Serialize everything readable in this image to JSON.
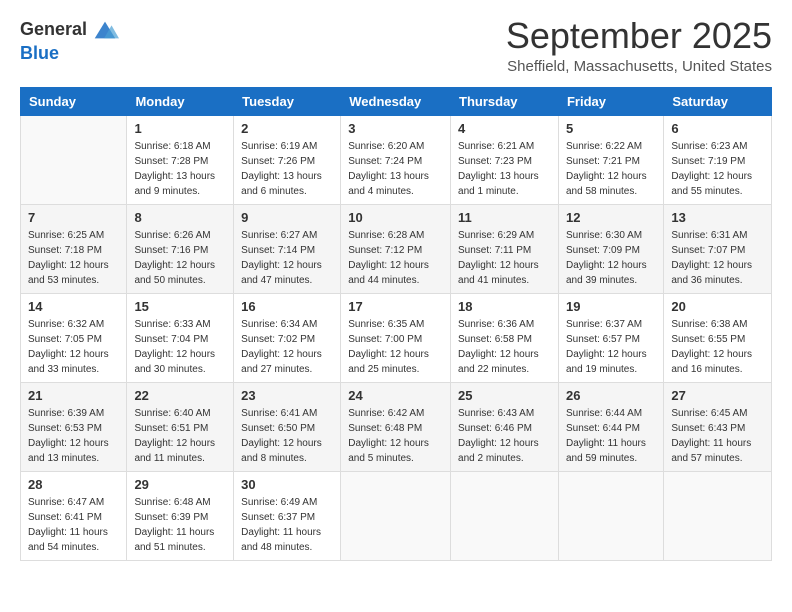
{
  "logo": {
    "general": "General",
    "blue": "Blue"
  },
  "header": {
    "month": "September 2025",
    "location": "Sheffield, Massachusetts, United States"
  },
  "weekdays": [
    "Sunday",
    "Monday",
    "Tuesday",
    "Wednesday",
    "Thursday",
    "Friday",
    "Saturday"
  ],
  "weeks": [
    [
      {
        "day": "",
        "sunrise": "",
        "sunset": "",
        "daylight": ""
      },
      {
        "day": "1",
        "sunrise": "Sunrise: 6:18 AM",
        "sunset": "Sunset: 7:28 PM",
        "daylight": "Daylight: 13 hours and 9 minutes."
      },
      {
        "day": "2",
        "sunrise": "Sunrise: 6:19 AM",
        "sunset": "Sunset: 7:26 PM",
        "daylight": "Daylight: 13 hours and 6 minutes."
      },
      {
        "day": "3",
        "sunrise": "Sunrise: 6:20 AM",
        "sunset": "Sunset: 7:24 PM",
        "daylight": "Daylight: 13 hours and 4 minutes."
      },
      {
        "day": "4",
        "sunrise": "Sunrise: 6:21 AM",
        "sunset": "Sunset: 7:23 PM",
        "daylight": "Daylight: 13 hours and 1 minute."
      },
      {
        "day": "5",
        "sunrise": "Sunrise: 6:22 AM",
        "sunset": "Sunset: 7:21 PM",
        "daylight": "Daylight: 12 hours and 58 minutes."
      },
      {
        "day": "6",
        "sunrise": "Sunrise: 6:23 AM",
        "sunset": "Sunset: 7:19 PM",
        "daylight": "Daylight: 12 hours and 55 minutes."
      }
    ],
    [
      {
        "day": "7",
        "sunrise": "Sunrise: 6:25 AM",
        "sunset": "Sunset: 7:18 PM",
        "daylight": "Daylight: 12 hours and 53 minutes."
      },
      {
        "day": "8",
        "sunrise": "Sunrise: 6:26 AM",
        "sunset": "Sunset: 7:16 PM",
        "daylight": "Daylight: 12 hours and 50 minutes."
      },
      {
        "day": "9",
        "sunrise": "Sunrise: 6:27 AM",
        "sunset": "Sunset: 7:14 PM",
        "daylight": "Daylight: 12 hours and 47 minutes."
      },
      {
        "day": "10",
        "sunrise": "Sunrise: 6:28 AM",
        "sunset": "Sunset: 7:12 PM",
        "daylight": "Daylight: 12 hours and 44 minutes."
      },
      {
        "day": "11",
        "sunrise": "Sunrise: 6:29 AM",
        "sunset": "Sunset: 7:11 PM",
        "daylight": "Daylight: 12 hours and 41 minutes."
      },
      {
        "day": "12",
        "sunrise": "Sunrise: 6:30 AM",
        "sunset": "Sunset: 7:09 PM",
        "daylight": "Daylight: 12 hours and 39 minutes."
      },
      {
        "day": "13",
        "sunrise": "Sunrise: 6:31 AM",
        "sunset": "Sunset: 7:07 PM",
        "daylight": "Daylight: 12 hours and 36 minutes."
      }
    ],
    [
      {
        "day": "14",
        "sunrise": "Sunrise: 6:32 AM",
        "sunset": "Sunset: 7:05 PM",
        "daylight": "Daylight: 12 hours and 33 minutes."
      },
      {
        "day": "15",
        "sunrise": "Sunrise: 6:33 AM",
        "sunset": "Sunset: 7:04 PM",
        "daylight": "Daylight: 12 hours and 30 minutes."
      },
      {
        "day": "16",
        "sunrise": "Sunrise: 6:34 AM",
        "sunset": "Sunset: 7:02 PM",
        "daylight": "Daylight: 12 hours and 27 minutes."
      },
      {
        "day": "17",
        "sunrise": "Sunrise: 6:35 AM",
        "sunset": "Sunset: 7:00 PM",
        "daylight": "Daylight: 12 hours and 25 minutes."
      },
      {
        "day": "18",
        "sunrise": "Sunrise: 6:36 AM",
        "sunset": "Sunset: 6:58 PM",
        "daylight": "Daylight: 12 hours and 22 minutes."
      },
      {
        "day": "19",
        "sunrise": "Sunrise: 6:37 AM",
        "sunset": "Sunset: 6:57 PM",
        "daylight": "Daylight: 12 hours and 19 minutes."
      },
      {
        "day": "20",
        "sunrise": "Sunrise: 6:38 AM",
        "sunset": "Sunset: 6:55 PM",
        "daylight": "Daylight: 12 hours and 16 minutes."
      }
    ],
    [
      {
        "day": "21",
        "sunrise": "Sunrise: 6:39 AM",
        "sunset": "Sunset: 6:53 PM",
        "daylight": "Daylight: 12 hours and 13 minutes."
      },
      {
        "day": "22",
        "sunrise": "Sunrise: 6:40 AM",
        "sunset": "Sunset: 6:51 PM",
        "daylight": "Daylight: 12 hours and 11 minutes."
      },
      {
        "day": "23",
        "sunrise": "Sunrise: 6:41 AM",
        "sunset": "Sunset: 6:50 PM",
        "daylight": "Daylight: 12 hours and 8 minutes."
      },
      {
        "day": "24",
        "sunrise": "Sunrise: 6:42 AM",
        "sunset": "Sunset: 6:48 PM",
        "daylight": "Daylight: 12 hours and 5 minutes."
      },
      {
        "day": "25",
        "sunrise": "Sunrise: 6:43 AM",
        "sunset": "Sunset: 6:46 PM",
        "daylight": "Daylight: 12 hours and 2 minutes."
      },
      {
        "day": "26",
        "sunrise": "Sunrise: 6:44 AM",
        "sunset": "Sunset: 6:44 PM",
        "daylight": "Daylight: 11 hours and 59 minutes."
      },
      {
        "day": "27",
        "sunrise": "Sunrise: 6:45 AM",
        "sunset": "Sunset: 6:43 PM",
        "daylight": "Daylight: 11 hours and 57 minutes."
      }
    ],
    [
      {
        "day": "28",
        "sunrise": "Sunrise: 6:47 AM",
        "sunset": "Sunset: 6:41 PM",
        "daylight": "Daylight: 11 hours and 54 minutes."
      },
      {
        "day": "29",
        "sunrise": "Sunrise: 6:48 AM",
        "sunset": "Sunset: 6:39 PM",
        "daylight": "Daylight: 11 hours and 51 minutes."
      },
      {
        "day": "30",
        "sunrise": "Sunrise: 6:49 AM",
        "sunset": "Sunset: 6:37 PM",
        "daylight": "Daylight: 11 hours and 48 minutes."
      },
      {
        "day": "",
        "sunrise": "",
        "sunset": "",
        "daylight": ""
      },
      {
        "day": "",
        "sunrise": "",
        "sunset": "",
        "daylight": ""
      },
      {
        "day": "",
        "sunrise": "",
        "sunset": "",
        "daylight": ""
      },
      {
        "day": "",
        "sunrise": "",
        "sunset": "",
        "daylight": ""
      }
    ]
  ]
}
